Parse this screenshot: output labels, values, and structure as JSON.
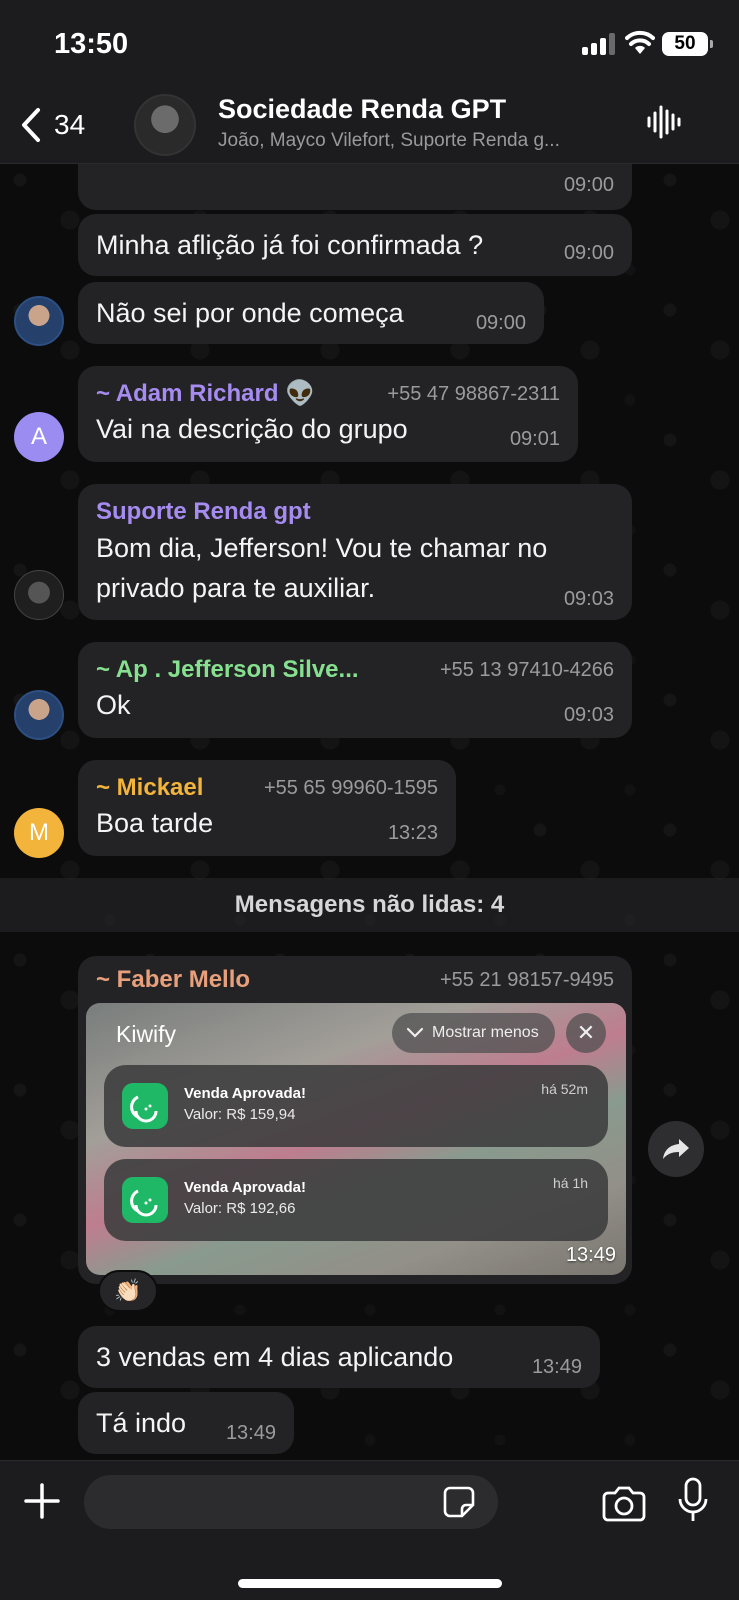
{
  "status_bar": {
    "time": "13:50",
    "battery": "50"
  },
  "header": {
    "back_count": "34",
    "title": "Sociedade Renda GPT",
    "members": "João, Mayco Vilefort, Suporte Renda g..."
  },
  "messages": [
    {
      "time": "09:00"
    },
    {
      "text": "Minha aflição já foi confirmada ?",
      "time": "09:00"
    },
    {
      "text": "Não sei por onde começa",
      "time": "09:00"
    },
    {
      "sender": "~ Adam Richard 👽",
      "sender_color": "#a68cf0",
      "phone": "+55 47 98867-2311",
      "text": "Vai na descrição do grupo",
      "time": "09:01",
      "avatar_letter": "A",
      "avatar_color": "#9b8cf2"
    },
    {
      "sender": "Suporte Renda gpt",
      "sender_color": "#a68cf0",
      "text": "Bom dia, Jefferson! Vou te chamar no privado para te auxiliar.",
      "time": "09:03"
    },
    {
      "sender": "~ Ap . Jefferson Silve...",
      "sender_color": "#86e08f",
      "phone": "+55 13 97410-4266",
      "text": "Ok",
      "time": "09:03"
    },
    {
      "sender": "~ Mickael",
      "sender_color": "#f2b43a",
      "phone": "+55 65 99960-1595",
      "text": "Boa tarde",
      "time": "13:23",
      "avatar_letter": "M",
      "avatar_color": "#f2b43a"
    }
  ],
  "unread_divider": "Mensagens não lidas: 4",
  "faber_message": {
    "sender": "~ Faber Mello",
    "sender_color": "#e8a07c",
    "phone": "+55 21 98157-9495",
    "image": {
      "app_label": "Kiwify",
      "show_less": "Mostrar menos",
      "notifications": [
        {
          "title": "Venda Aprovada!",
          "value": "Valor: R$ 159,94",
          "time": "há 52m"
        },
        {
          "title": "Venda Aprovada!",
          "value": "Valor: R$ 192,66",
          "time": "há 1h"
        }
      ]
    },
    "time": "13:49",
    "reaction": "👏🏻"
  },
  "followups": [
    {
      "text": "3 vendas em 4 dias aplicando",
      "time": "13:49"
    },
    {
      "text": "Tá indo",
      "time": "13:49"
    }
  ],
  "input": {
    "placeholder": ""
  }
}
